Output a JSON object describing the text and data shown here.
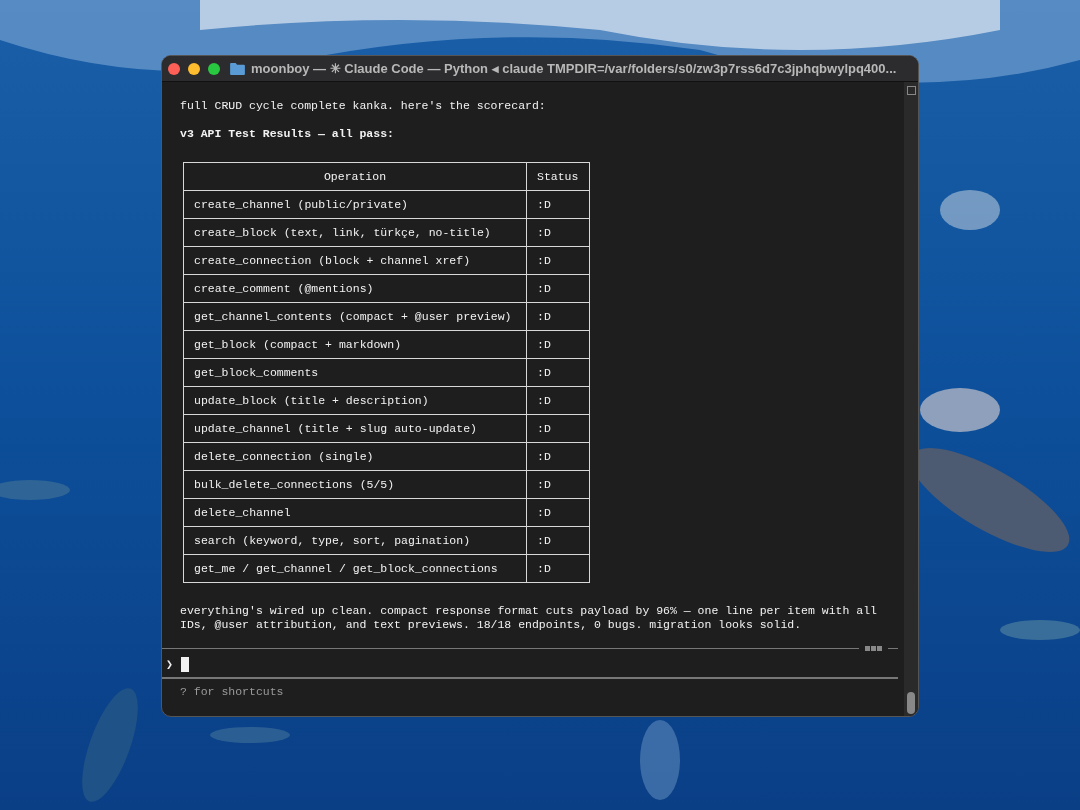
{
  "window": {
    "title": "moonboy — ✳ Claude Code — Python ◂ claude TMPDIR=/var/folders/s0/zw3p7rss6d7c3jphqbwylpq400..."
  },
  "intro": "full CRUD cycle complete kanka. here's the scorecard:",
  "heading": "v3 API Test Results — all pass:",
  "table": {
    "columns": [
      "Operation",
      "Status"
    ],
    "rows": [
      [
        "create_channel (public/private)",
        ":D"
      ],
      [
        "create_block (text, link, türkçe, no-title)",
        ":D"
      ],
      [
        "create_connection (block + channel xref)",
        ":D"
      ],
      [
        "create_comment (@mentions)",
        ":D"
      ],
      [
        "get_channel_contents (compact + @user preview)",
        ":D"
      ],
      [
        "get_block (compact + markdown)",
        ":D"
      ],
      [
        "get_block_comments",
        ":D"
      ],
      [
        "update_block (title + description)",
        ":D"
      ],
      [
        "update_channel (title + slug auto-update)",
        ":D"
      ],
      [
        "delete_connection (single)",
        ":D"
      ],
      [
        "bulk_delete_connections (5/5)",
        ":D"
      ],
      [
        "delete_channel",
        ":D"
      ],
      [
        "search (keyword, type, sort, pagination)",
        ":D"
      ],
      [
        "get_me / get_channel / get_block_connections",
        ":D"
      ]
    ]
  },
  "summary": [
    "everything's wired up clean. compact response format cuts payload by 96% — one line per item with all",
    "IDs, @user attribution, and text previews. 18/18 endpoints, 0 bugs. migration looks solid."
  ],
  "prompt": {
    "symbol": "❯"
  },
  "hint": "? for shortcuts"
}
